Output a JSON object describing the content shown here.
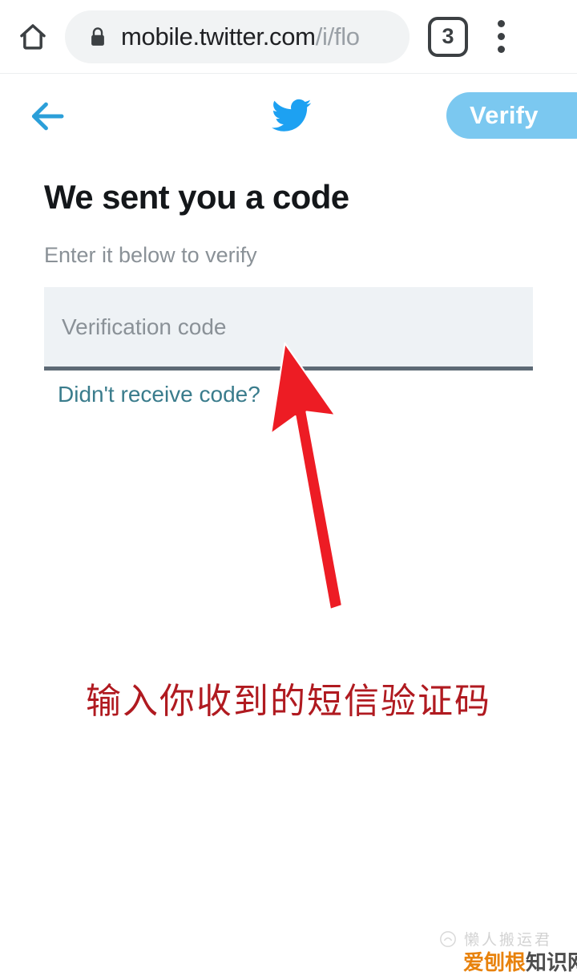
{
  "browser": {
    "home_icon": "home-icon",
    "lock_icon": "lock-icon",
    "url_domain": "mobile.twitter.com",
    "url_path": "/i/flo",
    "tab_count": "3",
    "menu_icon": "three-dot-menu-icon"
  },
  "twitter_header": {
    "back_icon": "back-arrow-icon",
    "logo_icon": "twitter-bird-icon",
    "verify_label": "Verify",
    "verify_color": "#7bc8f0",
    "brand_color": "#1da1f2"
  },
  "content": {
    "heading": "We sent you a code",
    "subheading": "Enter it below to verify",
    "code_placeholder": "Verification code",
    "code_value": "",
    "resend_label": "Didn't receive code?",
    "resend_color": "#3a7c8c",
    "field_bg": "#eef2f5",
    "field_underline": "#5d6a75"
  },
  "annotation": {
    "arrow_icon": "red-up-arrow-annotation",
    "arrow_color": "#ed1c24",
    "caption": "输入你收到的短信验证码",
    "caption_color": "#b01a20"
  },
  "watermark": {
    "logo_icon": "watermark-logo-icon",
    "top_text": "懒人搬运君",
    "bottom_text_orange": "爱刨根",
    "bottom_text_gray": "知识网",
    "orange": "#e8820c",
    "gray": "#4d4d4d"
  }
}
